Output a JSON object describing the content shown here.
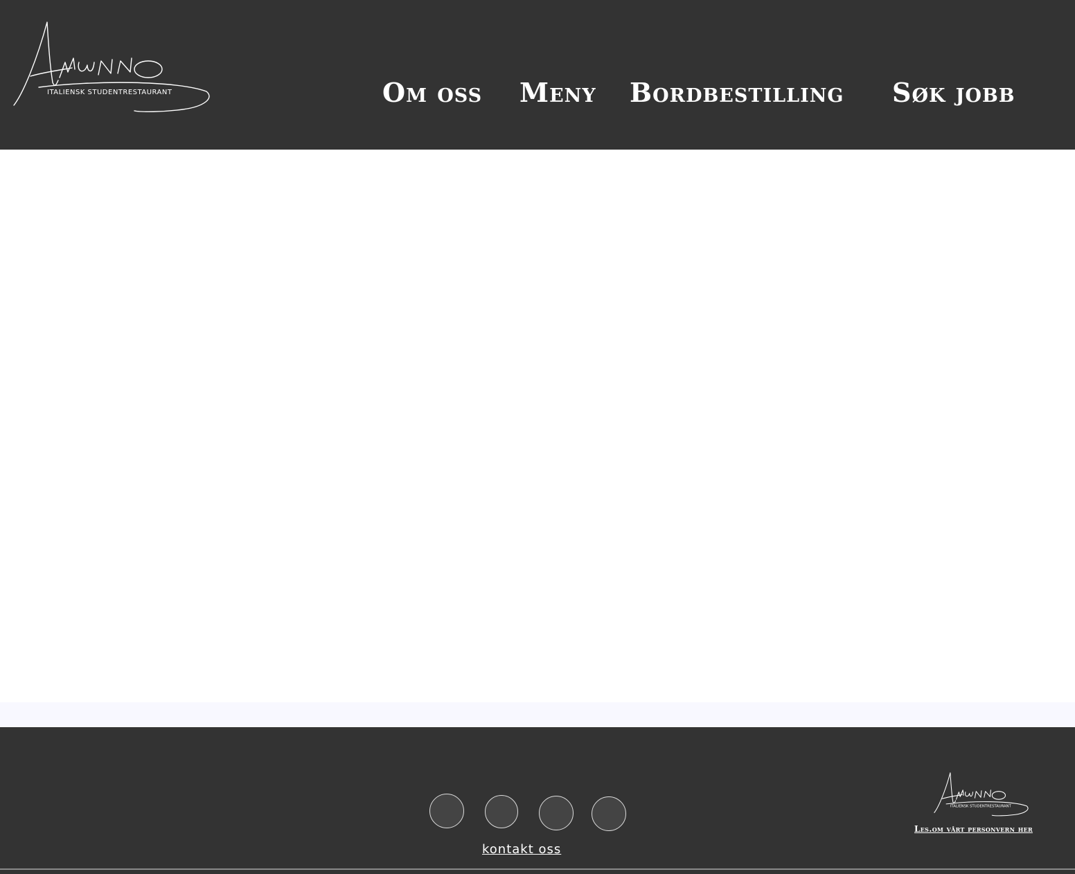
{
  "header": {
    "logo": {
      "name": "Alunno",
      "tagline": "Italiensk studentrestaurant",
      "icon": "alunno-signature-logo"
    },
    "nav": [
      {
        "label": "Om oss"
      },
      {
        "label": "Meny"
      },
      {
        "label": "Bordbestilling"
      },
      {
        "label": "Søk jobb"
      }
    ]
  },
  "footer": {
    "social_icons": [
      "social-icon",
      "social-icon",
      "social-icon",
      "social-icon"
    ],
    "contact_label": "kontakt oss",
    "privacy_label": "Les.om vårt personvern her"
  },
  "colors": {
    "header_bg": "#333333",
    "footer_bg": "#333333",
    "text": "#ffffff",
    "strip_bg": "#f8f8ff"
  }
}
